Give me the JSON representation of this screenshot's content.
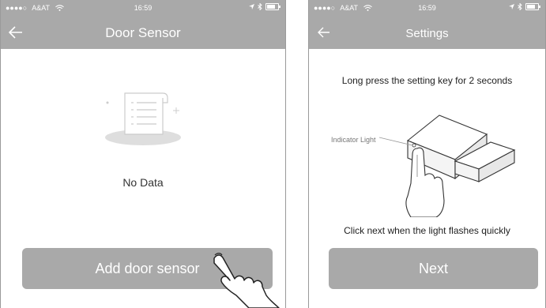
{
  "left_screen": {
    "status": {
      "signal": "●●●●○",
      "carrier": "A&AT",
      "time": "16:59"
    },
    "title": "Door Sensor",
    "empty_message": "No Data",
    "add_button_label": "Add door sensor"
  },
  "right_screen": {
    "status": {
      "signal": "●●●●○",
      "carrier": "A&AT",
      "time": "16:59"
    },
    "title": "Settings",
    "instruction_top": "Long press the setting key for 2 seconds",
    "indicator_label": "Indicator Light",
    "instruction_bottom": "Click next when the light flashes quickly",
    "next_button_label": "Next"
  },
  "colors": {
    "header": "#a9a9a9",
    "button": "#a9a9a9",
    "background": "#ffffff"
  }
}
